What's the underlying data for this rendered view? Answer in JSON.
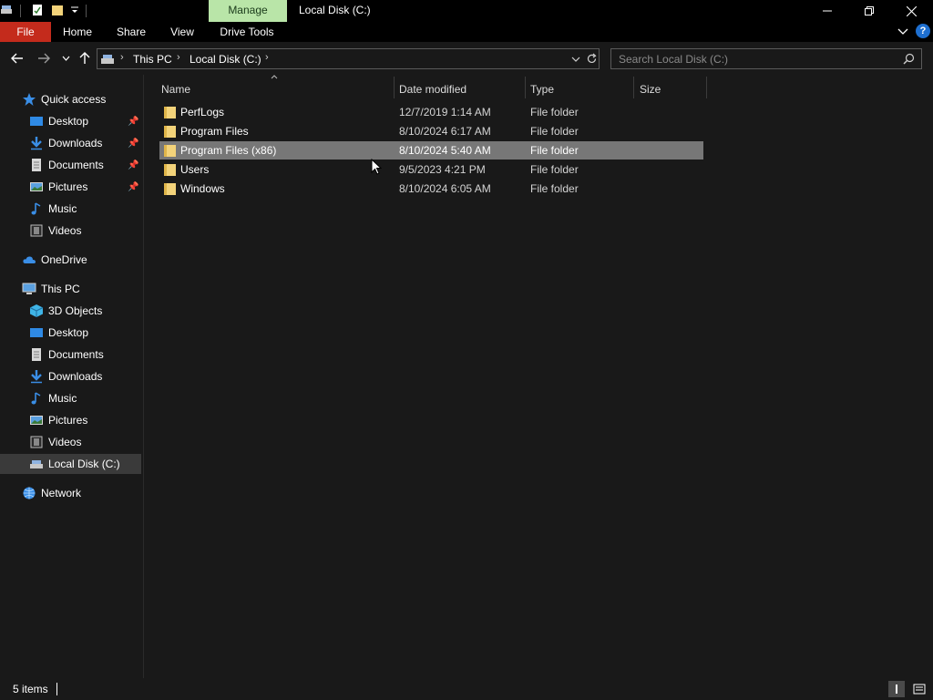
{
  "window": {
    "title": "Local Disk (C:)",
    "contextual_tab": "Manage",
    "minimize": "—",
    "maximize": "❐",
    "close": "✕"
  },
  "ribbon": {
    "tabs": [
      "File",
      "Home",
      "Share",
      "View",
      "Drive Tools"
    ],
    "collapse_icon": "chevron-down-icon",
    "help_label": "?"
  },
  "address": {
    "segments": [
      "This PC",
      "Local Disk (C:)"
    ],
    "search_placeholder": "Search Local Disk (C:)"
  },
  "sidebar": {
    "quick_access": {
      "label": "Quick access",
      "items": [
        {
          "label": "Desktop",
          "icon": "desktop-icon",
          "pinned": true
        },
        {
          "label": "Downloads",
          "icon": "download-icon",
          "pinned": true
        },
        {
          "label": "Documents",
          "icon": "document-icon",
          "pinned": true
        },
        {
          "label": "Pictures",
          "icon": "pictures-icon",
          "pinned": true
        },
        {
          "label": "Music",
          "icon": "music-icon",
          "pinned": false
        },
        {
          "label": "Videos",
          "icon": "video-icon",
          "pinned": false
        }
      ]
    },
    "onedrive": {
      "label": "OneDrive",
      "icon": "cloud-icon"
    },
    "this_pc": {
      "label": "This PC",
      "items": [
        {
          "label": "3D Objects",
          "icon": "cube-icon"
        },
        {
          "label": "Desktop",
          "icon": "desktop-icon"
        },
        {
          "label": "Documents",
          "icon": "document-icon"
        },
        {
          "label": "Downloads",
          "icon": "download-icon"
        },
        {
          "label": "Music",
          "icon": "music-icon"
        },
        {
          "label": "Pictures",
          "icon": "pictures-icon"
        },
        {
          "label": "Videos",
          "icon": "video-icon"
        },
        {
          "label": "Local Disk (C:)",
          "icon": "drive-icon",
          "selected": true
        }
      ]
    },
    "network": {
      "label": "Network",
      "icon": "network-icon"
    }
  },
  "columns": [
    "Name",
    "Date modified",
    "Type",
    "Size"
  ],
  "files": [
    {
      "name": "PerfLogs",
      "date": "12/7/2019 1:14 AM",
      "type": "File folder",
      "size": ""
    },
    {
      "name": "Program Files",
      "date": "8/10/2024 6:17 AM",
      "type": "File folder",
      "size": ""
    },
    {
      "name": "Program Files (x86)",
      "date": "8/10/2024 5:40 AM",
      "type": "File folder",
      "size": "",
      "selected": true
    },
    {
      "name": "Users",
      "date": "9/5/2023 4:21 PM",
      "type": "File folder",
      "size": ""
    },
    {
      "name": "Windows",
      "date": "8/10/2024 6:05 AM",
      "type": "File folder",
      "size": ""
    }
  ],
  "status": {
    "item_count": "5 items"
  },
  "colors": {
    "accent_file_tab": "#c42b1c",
    "manage_tab": "#b9e5a8",
    "folder": "#f3d37a",
    "selection": "#777777"
  }
}
